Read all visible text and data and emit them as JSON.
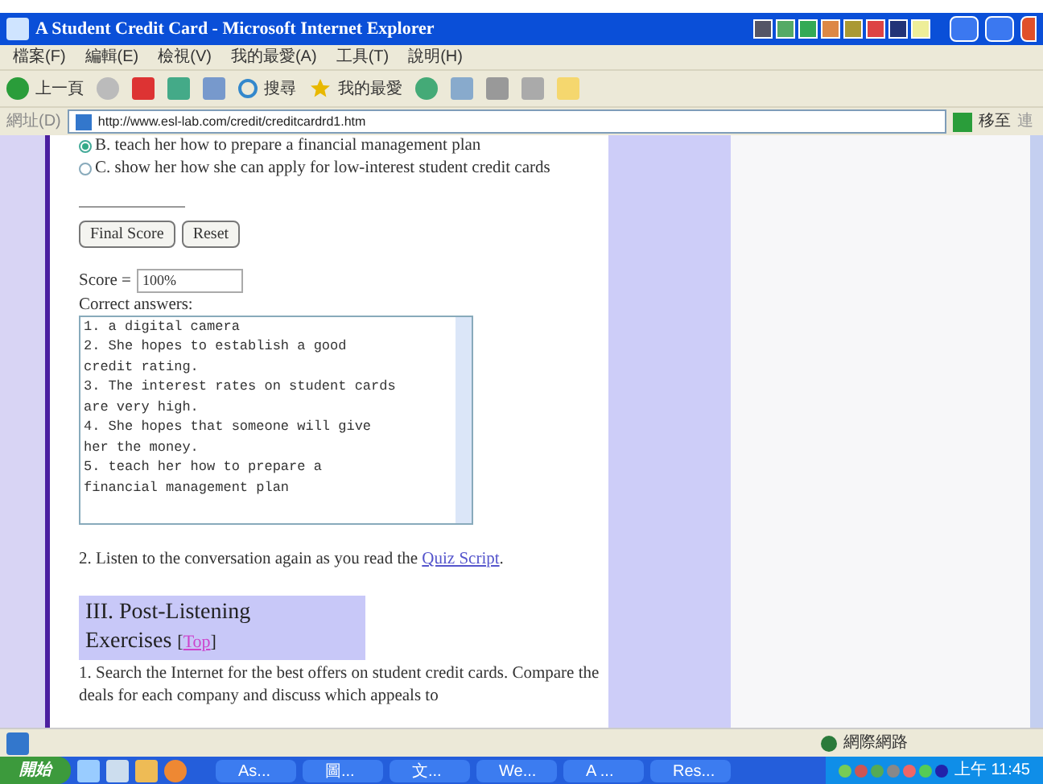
{
  "window": {
    "title": "A Student Credit Card - Microsoft Internet Explorer"
  },
  "menu": [
    "檔案(F)",
    "編輯(E)",
    "檢視(V)",
    "我的最愛(A)",
    "工具(T)",
    "說明(H)"
  ],
  "toolbar": {
    "back": "上一頁",
    "search": "搜尋",
    "favorites": "我的最愛"
  },
  "address": {
    "label": "網址(D)",
    "value": "http://www.esl-lab.com/credit/creditcardrd1.htm",
    "go": "移至",
    "links": "連"
  },
  "options": [
    {
      "label": "B. teach her how to prepare a financial management plan",
      "selected": true
    },
    {
      "label": "C. show her how she can apply for low-interest student credit cards",
      "selected": false
    }
  ],
  "buttons": [
    "Final Score",
    "Reset"
  ],
  "score": {
    "label": "Score =",
    "value": "100%"
  },
  "answers": {
    "label": "Correct answers:",
    "lines": [
      "1. a digital camera",
      "2. She hopes to establish a good",
      "credit rating.",
      "3. The interest rates on student cards",
      "are very high.",
      "4. She hopes that someone will give",
      "her the money.",
      "5. teach her how to prepare a",
      "financial management plan"
    ]
  },
  "step2": {
    "text": "2. Listen to the conversation again as you read the",
    "link": "Quiz Script",
    "end": "."
  },
  "section": {
    "title": "III. Post-Listening Exercises",
    "link": "[Top]"
  },
  "step3": "1. Search the Internet for the best offers on student credit cards. Compare the deals for each company and discuss which appeals to",
  "status": {
    "zone": "網際網路"
  },
  "taskbar": {
    "start": "開始",
    "tasks": [
      "As...",
      "圖...",
      "文...",
      "We...",
      "A ...",
      "Res..."
    ],
    "clock": "上午 11:45"
  }
}
